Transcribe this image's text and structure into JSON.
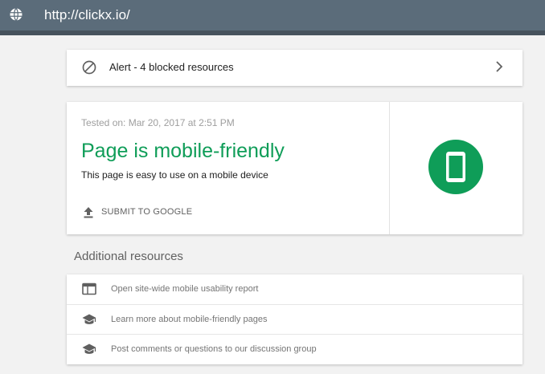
{
  "colors": {
    "topbar": "#5b6c7a",
    "accent_green": "#0f9d58",
    "page_background": "#f2f2f2"
  },
  "header": {
    "url": "http://clickx.io/",
    "icon": "globe-icon"
  },
  "alert": {
    "label": "Alert - 4 blocked resources",
    "icon": "blocked-icon",
    "chevron_icon": "chevron-right-icon"
  },
  "result": {
    "tested_on": "Tested on: Mar 20, 2017 at 2:51 PM",
    "headline": "Page is mobile-friendly",
    "description": "This page is easy to use on a mobile device",
    "submit_label": "SUBMIT TO GOOGLE",
    "submit_icon": "upload-icon",
    "badge_icon": "mobile-phone-icon"
  },
  "additional": {
    "heading": "Additional resources",
    "items": [
      {
        "label": "Open site-wide mobile usability report",
        "icon": "web-report-icon"
      },
      {
        "label": "Learn more about mobile-friendly pages",
        "icon": "school-icon"
      },
      {
        "label": "Post comments or questions to our discussion group",
        "icon": "school-icon"
      }
    ]
  }
}
